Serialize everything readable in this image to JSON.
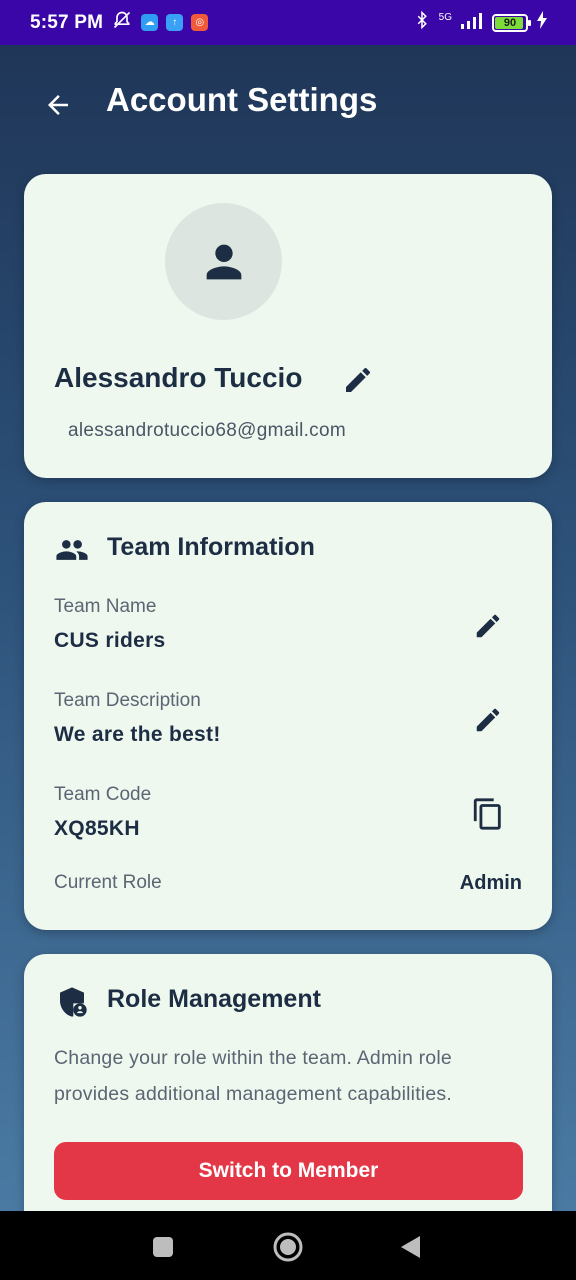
{
  "status_bar": {
    "time": "5:57 PM",
    "network": "5G",
    "battery": "90"
  },
  "header": {
    "title": "Account Settings",
    "back_icon": "arrow-left-icon"
  },
  "profile": {
    "name": "Alessandro Tuccio",
    "email": "alessandrotuccio68@gmail.com",
    "avatar_icon": "person-icon"
  },
  "team": {
    "section_title": "Team Information",
    "section_icon": "group-icon",
    "fields": [
      {
        "label": "Team Name",
        "value": "CUS riders",
        "action_icon": "pencil-icon"
      },
      {
        "label": "Team Description",
        "value": "We are the best!",
        "action_icon": "pencil-icon"
      },
      {
        "label": "Team Code",
        "value": "XQ85KH",
        "action_icon": "copy-icon"
      }
    ],
    "current_role_label": "Current Role",
    "current_role_value": "Admin"
  },
  "role_management": {
    "section_title": "Role Management",
    "section_icon": "admin-shield-icon",
    "description": "Change your role within the team. Admin role provides additional management capabilities.",
    "button_label": "Switch to Member",
    "button_color": "#e33747"
  },
  "colors": {
    "status_bar": "#3a06a8",
    "card_bg": "#eff8ee",
    "text_dark": "#1c2d44",
    "text_muted": "#5b6573"
  }
}
